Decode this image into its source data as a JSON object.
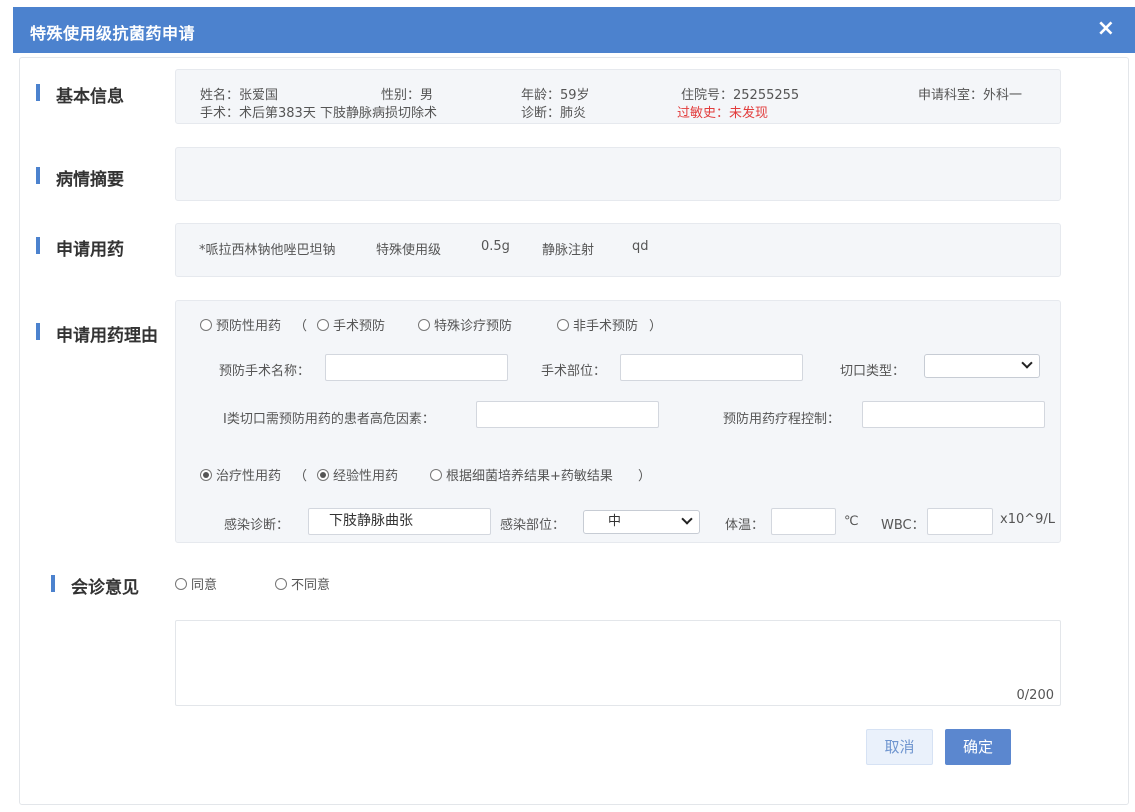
{
  "dialog": {
    "title": "特殊使用级抗菌药申请",
    "close_icon": "×"
  },
  "sections": {
    "basic": "基本信息",
    "summary": "病情摘要",
    "drug": "申请用药",
    "reason": "申请用药理由",
    "consult": "会诊意见"
  },
  "basic_info": {
    "name": "姓名：张爱国",
    "gender": "性别：男",
    "age": "年龄：59岁",
    "inpatient_no": "住院号：25255255",
    "dept": "申请科室：外科一",
    "surgery": "手术：术后第383天 下肢静脉病损切除术",
    "diagnosis": "诊断：肺炎",
    "allergy_label": "过敏史：",
    "allergy_value": "未发现"
  },
  "drug": {
    "name": "*哌拉西林钠他唑巴坦钠",
    "level": "特殊使用级",
    "dose": "0.5g",
    "route": "静脉注射",
    "freq": "qd"
  },
  "reason": {
    "prophylactic": "预防性用药",
    "paren_open": "（",
    "paren_close": "）",
    "opt_surgery": "手术预防",
    "opt_special": "特殊诊疗预防",
    "opt_nonsurgery": "非手术预防",
    "prev_surgery_name_label": "预防手术名称：",
    "surgery_site_label": "手术部位：",
    "incision_type_label": "切口类型：",
    "incision_type_value": "",
    "risk_factor_label": "Ⅰ类切口需预防用药的患者高危因素：",
    "course_control_label": "预防用药疗程控制：",
    "therapeutic": "治疗性用药",
    "opt_empirical": "经验性用药",
    "opt_culture": "根据细菌培养结果+药敏结果",
    "infection_dx_label": "感染诊断：",
    "infection_dx_value": "下肢静脉曲张",
    "infection_site_label": "感染部位：",
    "infection_site_value": "中",
    "temp_label": "体温：",
    "temp_unit": "℃",
    "wbc_label": "WBC：",
    "wbc_unit": "x10^9/L"
  },
  "consult": {
    "agree": "同意",
    "disagree": "不同意",
    "counter": "0/200"
  },
  "buttons": {
    "cancel": "取消",
    "ok": "确定"
  }
}
